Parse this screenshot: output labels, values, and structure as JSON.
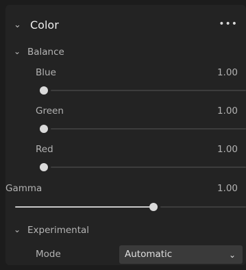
{
  "panel": {
    "title": "Color",
    "more_label": "•••"
  },
  "balance": {
    "title": "Balance",
    "sliders": [
      {
        "label": "Blue",
        "value": "1.00",
        "fraction": 0.0
      },
      {
        "label": "Green",
        "value": "1.00",
        "fraction": 0.0
      },
      {
        "label": "Red",
        "value": "1.00",
        "fraction": 0.0
      }
    ]
  },
  "gamma": {
    "label": "Gamma",
    "value": "1.00",
    "fraction": 0.6
  },
  "experimental": {
    "title": "Experimental",
    "mode_label": "Mode",
    "mode_value": "Automatic"
  },
  "icons": {
    "expand": "chevron-down-icon",
    "more": "more-icon"
  },
  "colors": {
    "panel_bg": "#232323",
    "thumb": "#dadada",
    "track": "#3d3d3d",
    "dropdown_bg": "#3a3a3a"
  }
}
